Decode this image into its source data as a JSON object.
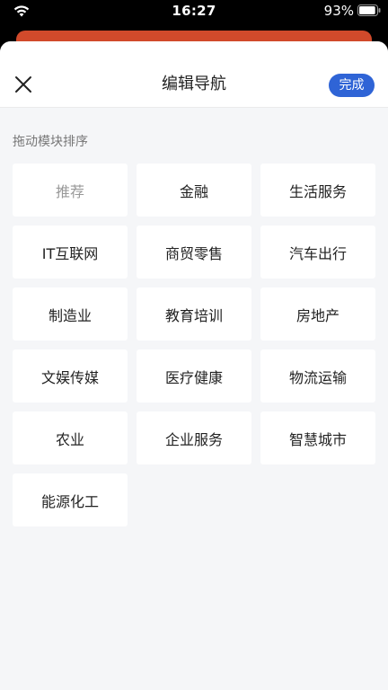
{
  "status_bar": {
    "time": "16:27",
    "battery_percent": "93%",
    "battery_level": 0.93
  },
  "header": {
    "title": "编辑导航",
    "done_label": "完成"
  },
  "section_label": "拖动模块排序",
  "modules": [
    {
      "label": "推荐",
      "fixed": true
    },
    {
      "label": "金融"
    },
    {
      "label": "生活服务"
    },
    {
      "label": "IT互联网"
    },
    {
      "label": "商贸零售"
    },
    {
      "label": "汽车出行"
    },
    {
      "label": "制造业"
    },
    {
      "label": "教育培训"
    },
    {
      "label": "房地产"
    },
    {
      "label": "文娱传媒"
    },
    {
      "label": "医疗健康"
    },
    {
      "label": "物流运输"
    },
    {
      "label": "农业"
    },
    {
      "label": "企业服务"
    },
    {
      "label": "智慧城市"
    },
    {
      "label": "能源化工"
    }
  ],
  "colors": {
    "accent": "#2f64d6",
    "header_band": "#d14a2b",
    "background": "#f5f6f8"
  }
}
